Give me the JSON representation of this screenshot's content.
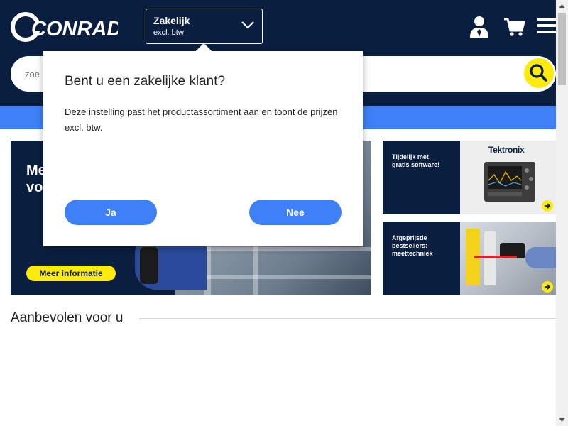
{
  "header": {
    "logo_text": "CONRAD",
    "business_switch": {
      "title": "Zakelijk",
      "subtitle": "excl. btw"
    },
    "icons": [
      "user-icon",
      "cart-icon",
      "menu-icon"
    ]
  },
  "search": {
    "placeholder": "zoe",
    "button_icon": "search-icon"
  },
  "hero": {
    "text": "Me\nvo",
    "button_label": "Meer informatie"
  },
  "side_banners": [
    {
      "text": "Tijdelijk met\ngratis software!",
      "brand": "Tektronix"
    },
    {
      "text": "Afgeprijsde\nbestsellers:\nmeettechniek"
    }
  ],
  "section": {
    "title": "Aanbevolen voor u"
  },
  "popup": {
    "title": "Bent u een zakelijke klant?",
    "description": "Deze instelling past het productassortiment aan en toont de prijzen excl. btw.",
    "yes_label": "Ja",
    "no_label": "Nee"
  },
  "colors": {
    "navy": "#0a1e3f",
    "accent_blue": "#3f80f6",
    "yellow": "#fdea0f"
  }
}
